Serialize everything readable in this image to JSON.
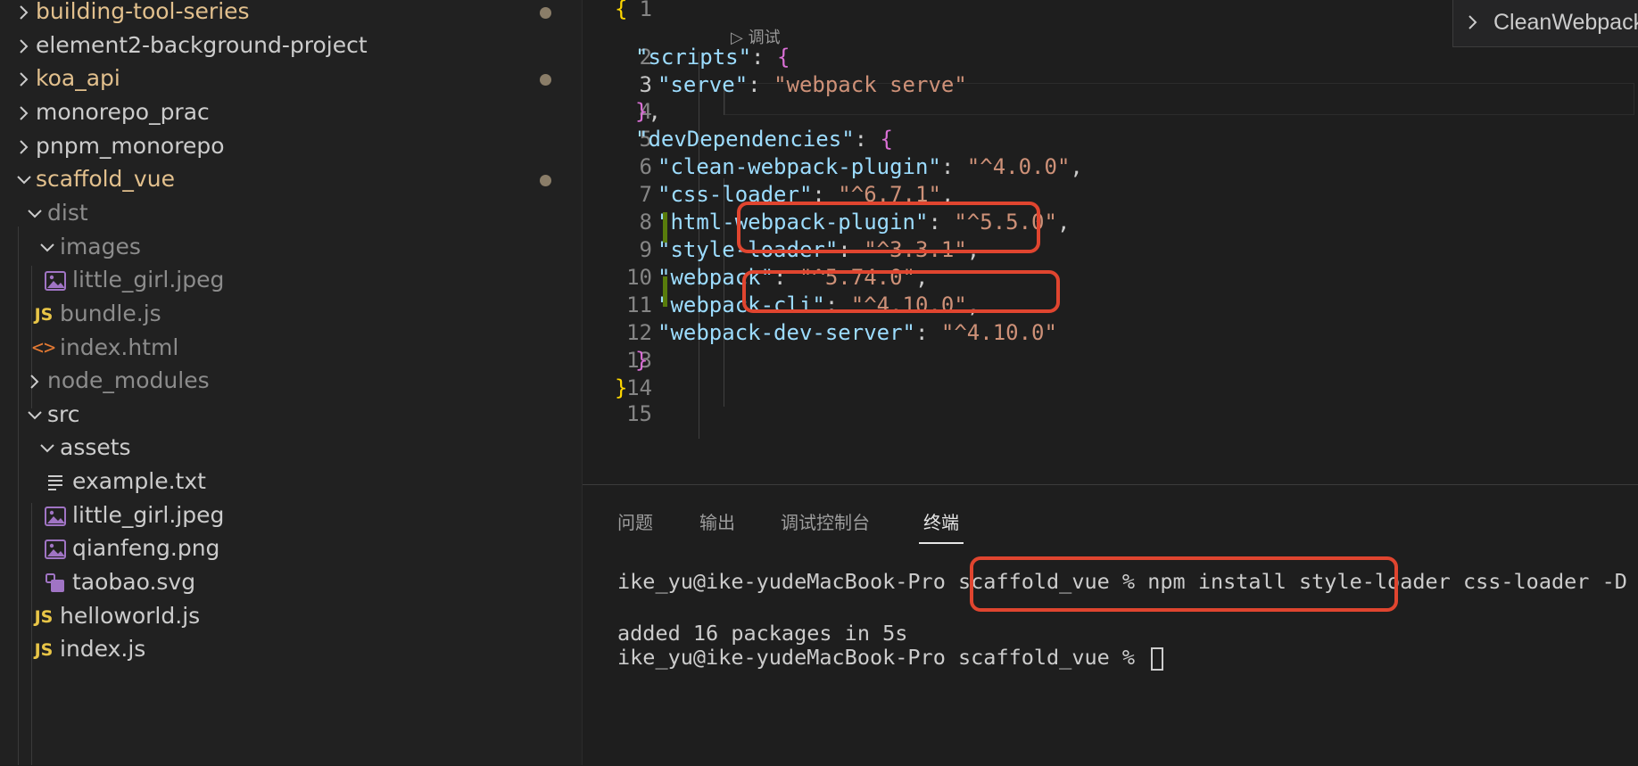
{
  "explorer": {
    "items": [
      {
        "label": "building-tool-series",
        "kind": "folder",
        "expanded": false,
        "depth": 0,
        "modified": true,
        "color": "#e2c08d"
      },
      {
        "label": "element2-background-project",
        "kind": "folder",
        "expanded": false,
        "depth": 0,
        "modified": false
      },
      {
        "label": "koa_api",
        "kind": "folder",
        "expanded": false,
        "depth": 0,
        "modified": true,
        "color": "#e2c08d"
      },
      {
        "label": "monorepo_prac",
        "kind": "folder",
        "expanded": false,
        "depth": 0,
        "modified": false
      },
      {
        "label": "pnpm_monorepo",
        "kind": "folder",
        "expanded": false,
        "depth": 0,
        "modified": false
      },
      {
        "label": "scaffold_vue",
        "kind": "folder",
        "expanded": true,
        "depth": 0,
        "modified": true,
        "color": "#e2c08d"
      },
      {
        "label": "dist",
        "kind": "folder",
        "expanded": true,
        "depth": 1,
        "dimmed": true
      },
      {
        "label": "images",
        "kind": "folder",
        "expanded": true,
        "depth": 2,
        "dimmed": true
      },
      {
        "label": "little_girl.jpeg",
        "kind": "image",
        "depth": 3,
        "dimmed": true
      },
      {
        "label": "bundle.js",
        "kind": "js",
        "depth": 2,
        "dimmed": true
      },
      {
        "label": "index.html",
        "kind": "html",
        "depth": 2,
        "dimmed": true
      },
      {
        "label": "node_modules",
        "kind": "folder",
        "expanded": false,
        "depth": 1,
        "dimmed": true
      },
      {
        "label": "src",
        "kind": "folder",
        "expanded": true,
        "depth": 1
      },
      {
        "label": "assets",
        "kind": "folder",
        "expanded": true,
        "depth": 2
      },
      {
        "label": "example.txt",
        "kind": "text",
        "depth": 3
      },
      {
        "label": "little_girl.jpeg",
        "kind": "image",
        "depth": 3
      },
      {
        "label": "qianfeng.png",
        "kind": "image",
        "depth": 3
      },
      {
        "label": "taobao.svg",
        "kind": "svg",
        "depth": 3
      },
      {
        "label": "helloworld.js",
        "kind": "js",
        "depth": 2
      },
      {
        "label": "index.js",
        "kind": "js",
        "depth": 2
      }
    ]
  },
  "editor": {
    "codelens": "调试",
    "active_line": 3,
    "lines": [
      {
        "n": "1",
        "tokens": [
          {
            "t": "{",
            "c": "b1"
          }
        ]
      },
      {
        "n": "2",
        "tokens": [
          {
            "t": "\"scripts\"",
            "c": "k"
          },
          {
            "t": ": ",
            "c": "p"
          },
          {
            "t": "{",
            "c": "b2"
          }
        ]
      },
      {
        "n": "3",
        "tokens": [
          {
            "t": "\"serve\"",
            "c": "k"
          },
          {
            "t": ": ",
            "c": "p"
          },
          {
            "t": "\"webpack serve\"",
            "c": "s"
          }
        ]
      },
      {
        "n": "4",
        "tokens": [
          {
            "t": "}",
            "c": "b2"
          },
          {
            "t": ",",
            "c": "p"
          }
        ]
      },
      {
        "n": "5",
        "tokens": [
          {
            "t": "\"devDependencies\"",
            "c": "k"
          },
          {
            "t": ": ",
            "c": "p"
          },
          {
            "t": "{",
            "c": "b2"
          }
        ]
      },
      {
        "n": "6",
        "tokens": [
          {
            "t": "\"clean-webpack-plugin\"",
            "c": "k"
          },
          {
            "t": ": ",
            "c": "p"
          },
          {
            "t": "\"^4.0.0\"",
            "c": "s"
          },
          {
            "t": ",",
            "c": "p"
          }
        ]
      },
      {
        "n": "7",
        "tokens": [
          {
            "t": "\"css-loader\"",
            "c": "k"
          },
          {
            "t": ": ",
            "c": "p"
          },
          {
            "t": "\"^6.7.1\"",
            "c": "s"
          },
          {
            "t": ",",
            "c": "p"
          }
        ]
      },
      {
        "n": "8",
        "tokens": [
          {
            "t": "\"html-webpack-plugin\"",
            "c": "k"
          },
          {
            "t": ": ",
            "c": "p"
          },
          {
            "t": "\"^5.5.0\"",
            "c": "s"
          },
          {
            "t": ",",
            "c": "p"
          }
        ]
      },
      {
        "n": "9",
        "tokens": [
          {
            "t": "\"style-loader\"",
            "c": "k"
          },
          {
            "t": ": ",
            "c": "p"
          },
          {
            "t": "\"^3.3.1\"",
            "c": "s"
          },
          {
            "t": ",",
            "c": "p"
          }
        ]
      },
      {
        "n": "10",
        "tokens": [
          {
            "t": "\"webpack\"",
            "c": "k"
          },
          {
            "t": ": ",
            "c": "p"
          },
          {
            "t": "\"^5.74.0\"",
            "c": "s"
          },
          {
            "t": ",",
            "c": "p"
          }
        ]
      },
      {
        "n": "11",
        "tokens": [
          {
            "t": "\"webpack-cli\"",
            "c": "k"
          },
          {
            "t": ": ",
            "c": "p"
          },
          {
            "t": "\"^4.10.0\"",
            "c": "s"
          },
          {
            "t": ",",
            "c": "p"
          }
        ]
      },
      {
        "n": "12",
        "tokens": [
          {
            "t": "\"webpack-dev-server\"",
            "c": "k"
          },
          {
            "t": ": ",
            "c": "p"
          },
          {
            "t": "\"^4.10.0\"",
            "c": "s"
          }
        ]
      },
      {
        "n": "13",
        "tokens": [
          {
            "t": "}",
            "c": "b2"
          }
        ]
      },
      {
        "n": "14",
        "tokens": [
          {
            "t": "}",
            "c": "b1"
          }
        ]
      },
      {
        "n": "15",
        "tokens": []
      }
    ]
  },
  "outline_widget": {
    "label": "CleanWebpack"
  },
  "panel": {
    "tabs": [
      {
        "label": "问题",
        "active": false
      },
      {
        "label": "输出",
        "active": false
      },
      {
        "label": "调试控制台",
        "active": false
      },
      {
        "label": "终端",
        "active": true
      }
    ],
    "terminal": {
      "prompt": "ike_yu@ike-yudeMacBook-Pro scaffold_vue % ",
      "command": "npm install style-loader css-loader -D",
      "output": "added 16 packages in 5s",
      "prompt2": "ike_yu@ike-yudeMacBook-Pro scaffold_vue % "
    }
  },
  "colors": {
    "annotation_red": "#e0452f",
    "modified_dot": "#8a7d68",
    "git_added": "#587c0c"
  }
}
